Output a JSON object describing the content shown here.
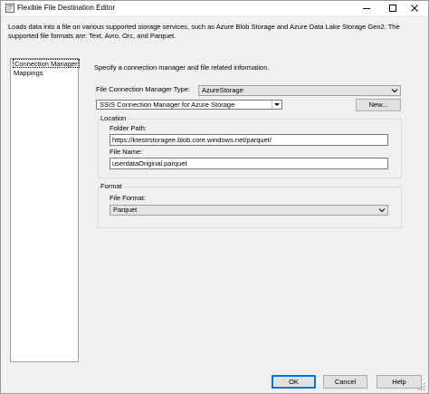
{
  "window": {
    "title": "Flexible File Destination Editor",
    "description": "Loads data into a file on various supported storage services, such as Azure Blob Storage and Azure Data Lake Storage Gen2. The supported file formats are: Text, Avro, Orc, and Parquet."
  },
  "nav": {
    "items": [
      {
        "label": "Connection Manager",
        "selected": true
      },
      {
        "label": "Mappings",
        "selected": false
      }
    ]
  },
  "main": {
    "instruction": "Specify a connection manager and file related information.",
    "conn_type_label": "File Connection Manager Type:",
    "conn_type_value": "AzureStorage",
    "conn_manager_value": "SSIS Connection Manager for Azure Storage",
    "new_button": "New...",
    "location": {
      "group_label": "Location",
      "folder_path_label": "Folder Path:",
      "folder_path_value": "https://ktestrstoragee.blob.core.windows.net/parquet/",
      "file_name_label": "File Name:",
      "file_name_value": "userdataOriginal.parquet"
    },
    "format": {
      "group_label": "Format",
      "file_format_label": "File Format:",
      "file_format_value": "Parquet"
    }
  },
  "footer": {
    "ok": "OK",
    "cancel": "Cancel",
    "help": "Help"
  }
}
